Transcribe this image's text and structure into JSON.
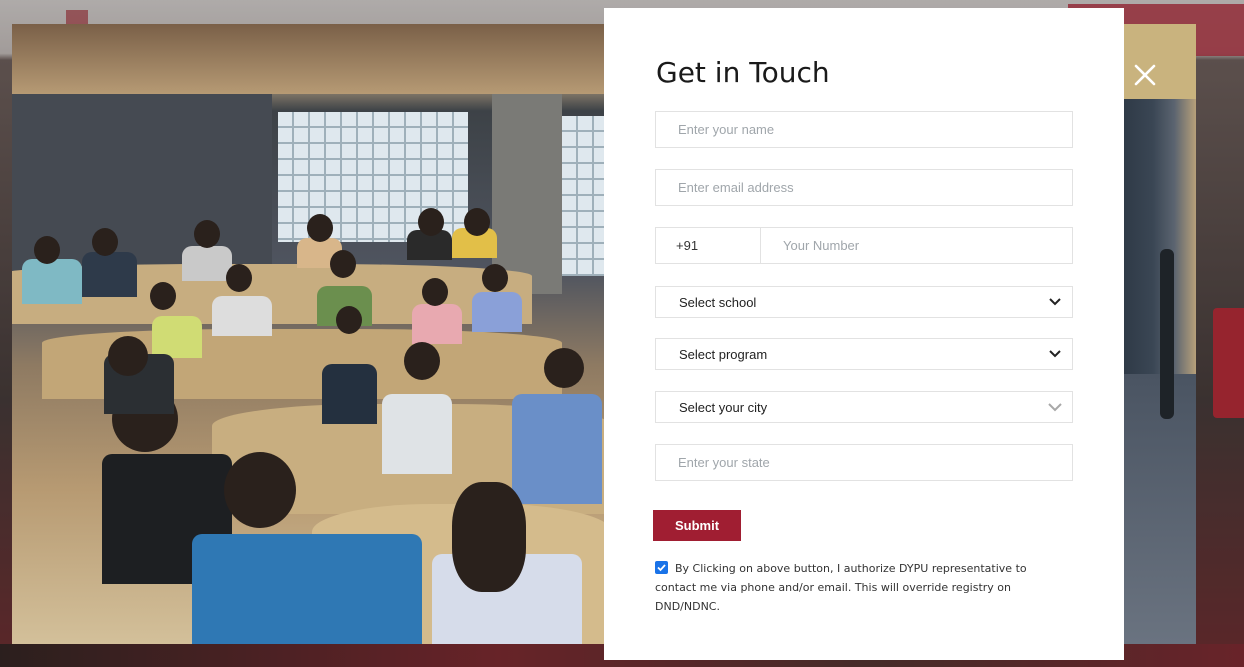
{
  "modal": {
    "title": "Get in Touch",
    "fields": {
      "name_placeholder": "Enter your name",
      "email_placeholder": "Enter email address",
      "phone_code": "+91",
      "phone_placeholder": "Your Number",
      "school_select": "Select school",
      "program_select": "Select program",
      "city_select": "Select your city",
      "state_placeholder": "Enter your state"
    },
    "submit_label": "Submit",
    "consent_text": "By Clicking on above button, I authorize DYPU representative to contact me via phone and/or email. This will override registry on DND/NDNC.",
    "consent_checked": true,
    "accent_color": "#a01e32",
    "close_icon": "close-icon"
  }
}
